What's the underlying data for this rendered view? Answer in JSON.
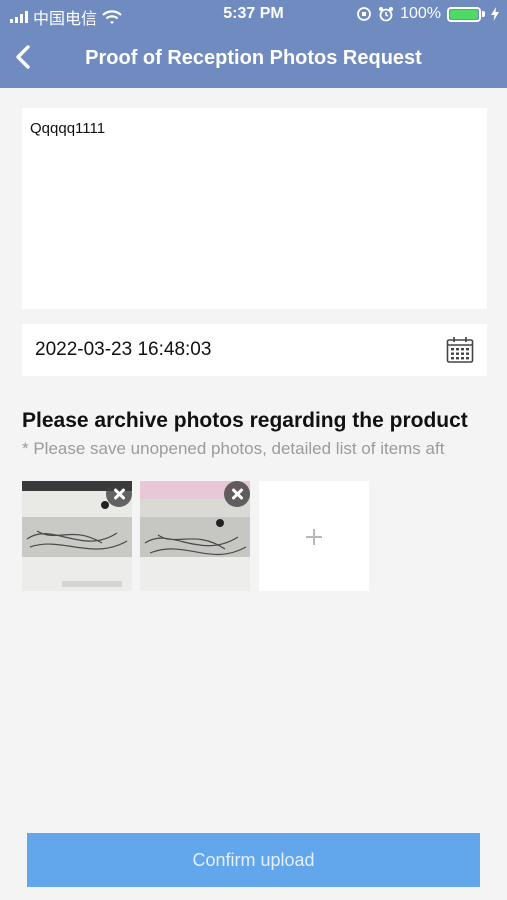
{
  "status_bar": {
    "carrier": "中国电信",
    "time": "5:37 PM",
    "battery": "100%",
    "battery_level": 1.0
  },
  "nav": {
    "title": "Proof of Reception Photos Request"
  },
  "message": {
    "value": "Qqqqq1111"
  },
  "date_field": {
    "value": "2022-03-23 16:48:03"
  },
  "photos_section": {
    "title": "Please archive photos regarding the product",
    "hint": "* Please save unopened photos, detailed list of items aft"
  },
  "photos": [
    {
      "icon": "remove-photo-icon"
    },
    {
      "icon": "remove-photo-icon"
    }
  ],
  "confirm": {
    "label": "Confirm upload"
  },
  "colors": {
    "header": "#6f8bc0",
    "button": "#62a6ec",
    "background": "#f4f4f4"
  }
}
